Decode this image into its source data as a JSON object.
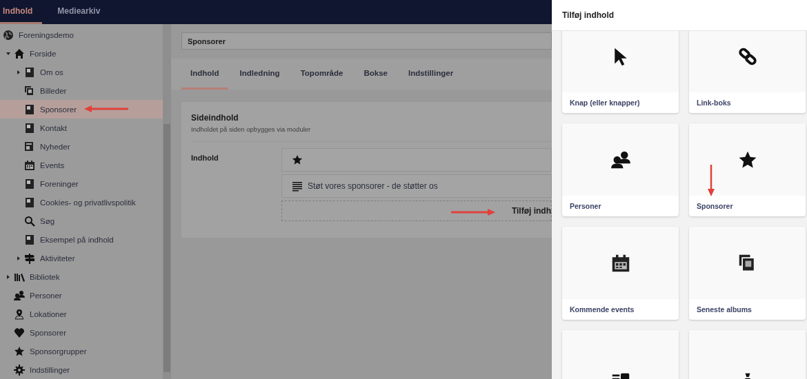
{
  "top_nav": {
    "tabs": [
      {
        "label": "Indhold",
        "selected": true
      },
      {
        "label": "Mediearkiv",
        "selected": false
      }
    ]
  },
  "sidebar": {
    "site": {
      "label": "Foreningsdemo"
    },
    "tree": [
      {
        "label": "Forside",
        "kind": "home",
        "expanded": true,
        "selected": false,
        "children": [
          {
            "label": "Om os",
            "kind": "page",
            "expanded": false,
            "selected": false
          },
          {
            "label": "Billeder",
            "kind": "gallery",
            "selected": false
          },
          {
            "label": "Sponsorer",
            "kind": "page",
            "selected": true
          },
          {
            "label": "Kontakt",
            "kind": "page",
            "selected": false
          },
          {
            "label": "Nyheder",
            "kind": "news",
            "selected": false
          },
          {
            "label": "Events",
            "kind": "calendar",
            "selected": false
          },
          {
            "label": "Foreninger",
            "kind": "page",
            "selected": false
          },
          {
            "label": "Cookies- og privatlivspolitik",
            "kind": "page",
            "selected": false
          },
          {
            "label": "Søg",
            "kind": "search",
            "selected": false
          },
          {
            "label": "Eksempel på indhold",
            "kind": "page",
            "selected": false
          },
          {
            "label": "Aktiviteter",
            "kind": "signpost",
            "expanded": false,
            "selected": false
          }
        ]
      },
      {
        "label": "Bibliotek",
        "kind": "books",
        "expanded": false,
        "selected": false
      },
      {
        "label": "Personer",
        "kind": "people",
        "selected": false
      },
      {
        "label": "Lokationer",
        "kind": "location",
        "selected": false
      },
      {
        "label": "Sponsorer",
        "kind": "heart",
        "selected": false
      },
      {
        "label": "Sponsorgrupper",
        "kind": "star",
        "selected": false
      },
      {
        "label": "Indstillinger",
        "kind": "gear",
        "selected": false
      }
    ]
  },
  "editor": {
    "page_name": "Sponsorer",
    "tabs": [
      {
        "label": "Indhold",
        "selected": true
      },
      {
        "label": "Indledning",
        "selected": false
      },
      {
        "label": "Topområde",
        "selected": false
      },
      {
        "label": "Bokse",
        "selected": false
      },
      {
        "label": "Indstillinger",
        "selected": false
      }
    ],
    "section": {
      "title": "Sideindhold",
      "subtitle": "Indholdet på siden opbygges via moduler",
      "field_label": "Indhold",
      "blocks": [
        {
          "kind": "star"
        },
        {
          "kind": "text",
          "label": "Støt vores sponsorer - de støtter os"
        }
      ],
      "add_button": "Tilføj indh"
    }
  },
  "panel": {
    "title": "Tilføj indhold",
    "cards": [
      {
        "kind": "cursor",
        "label": "Knap (eller knapper)"
      },
      {
        "kind": "link",
        "label": "Link-boks"
      },
      {
        "kind": "people",
        "label": "Personer"
      },
      {
        "kind": "star",
        "label": "Sponsorer"
      },
      {
        "kind": "calendar",
        "label": "Kommende events"
      },
      {
        "kind": "gallery",
        "label": "Seneste albums"
      },
      {
        "kind": "article"
      },
      {
        "kind": "money"
      }
    ]
  }
}
